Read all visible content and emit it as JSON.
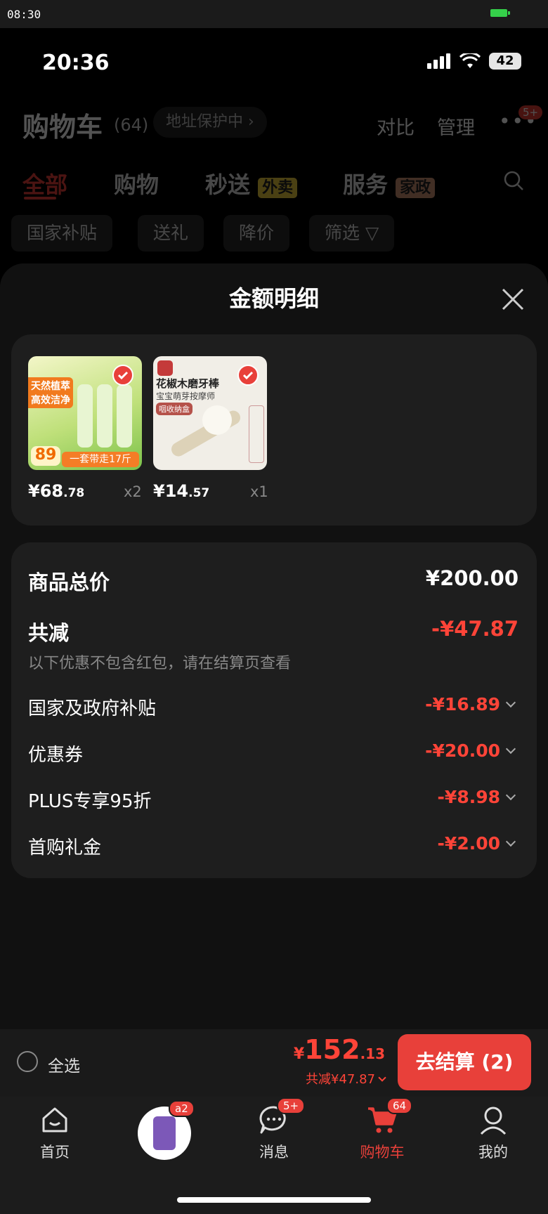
{
  "system": {
    "time": "08:30"
  },
  "status": {
    "time": "20:36",
    "battery": "42"
  },
  "cart": {
    "title": "购物车",
    "count": "(64)",
    "address_protect": "地址保护中 ›",
    "compare": "对比",
    "manage": "管理",
    "more_badge": "5+",
    "tabs": [
      {
        "label": "全部"
      },
      {
        "label": "购物"
      },
      {
        "label": "秒送",
        "tag": "外卖"
      },
      {
        "label": "服务",
        "tag": "家政"
      }
    ],
    "filters": [
      "国家补贴",
      "送礼",
      "降价",
      "筛选 ▽"
    ]
  },
  "sheet": {
    "title": "金额明细",
    "products": [
      {
        "img_line1": "天然植萃",
        "img_line2": "高效洁净",
        "img_price": "89",
        "img_banner": "一套带走17斤",
        "price_int": "¥68",
        "price_dec": ".78",
        "qty": "x2"
      },
      {
        "img_line1": "花椒木磨牙棒",
        "img_line2": "宝宝萌芽按摩师",
        "img_tag": "咽收纳盒",
        "price_int": "¥14",
        "price_dec": ".57",
        "qty": "x1"
      }
    ],
    "summary": {
      "total_label": "商品总价",
      "total_value": "¥200.00",
      "reduce_label": "共减",
      "reduce_value": "-¥47.87",
      "note": "以下优惠不包含红包，请在结算页查看",
      "rows": [
        {
          "label": "国家及政府补贴",
          "value": "-¥16.89"
        },
        {
          "label": "优惠券",
          "value": "-¥20.00"
        },
        {
          "label": "PLUS专享95折",
          "value": "-¥8.98"
        },
        {
          "label": "首购礼金",
          "value": "-¥2.00"
        }
      ]
    }
  },
  "checkout": {
    "select_all": "全选",
    "currency": "¥",
    "amount_int": "152",
    "amount_dec": ".13",
    "saved": "共减¥47.87",
    "button": "去结算 (2)"
  },
  "nav": [
    {
      "label": "首页"
    },
    {
      "label": "",
      "badge": "a2"
    },
    {
      "label": "消息",
      "badge": "5+"
    },
    {
      "label": "购物车",
      "badge": "64"
    },
    {
      "label": "我的"
    }
  ],
  "colors": {
    "accent": "#e8403a",
    "discount": "#ff4438"
  }
}
